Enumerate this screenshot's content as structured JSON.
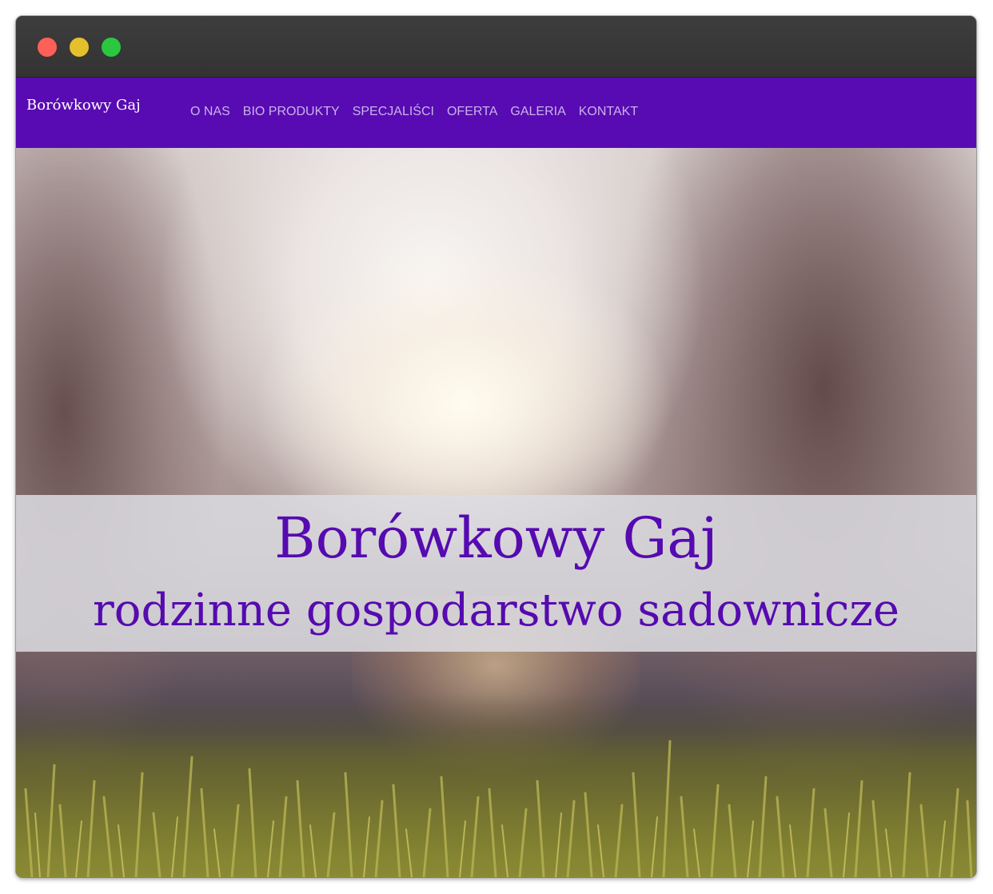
{
  "window": {
    "controls": [
      "close",
      "minimize",
      "zoom"
    ]
  },
  "navbar": {
    "brand": "Borówkowy Gaj",
    "links": [
      {
        "label": "O NAS"
      },
      {
        "label": "BIO PRODUKTY"
      },
      {
        "label": "SPECJALIŚCI"
      },
      {
        "label": "OFERTA"
      },
      {
        "label": "GALERIA"
      },
      {
        "label": "KONTAKT"
      }
    ]
  },
  "hero": {
    "title": "Borówkowy Gaj",
    "subtitle": "rodzinne gospodarstwo sadownicze"
  },
  "colors": {
    "navbar_bg": "#580bb2",
    "accent_text": "#560ab0",
    "nav_link": "#c9b3ea"
  }
}
